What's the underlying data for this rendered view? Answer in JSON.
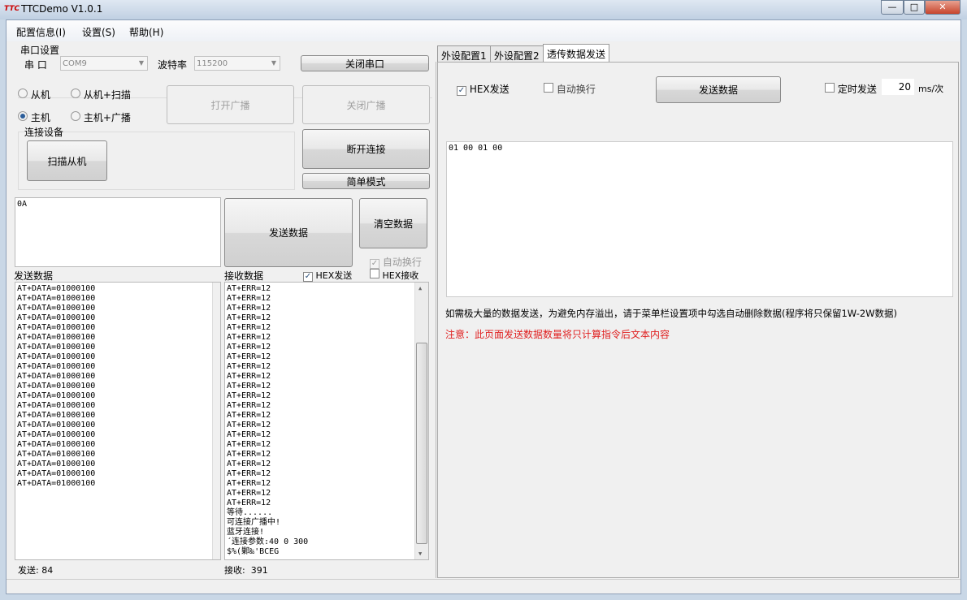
{
  "window": {
    "title": "TTCDemo V1.0.1",
    "logo": "TTC",
    "min": "—",
    "max": "□",
    "close": "✕"
  },
  "menu": [
    "配置信息(I)",
    "设置(S)",
    "帮助(H)"
  ],
  "serial": {
    "group_label": "串口设置",
    "port_label": "串 口",
    "port_value": "COM9",
    "baud_label": "波特率",
    "baud_value": "115200",
    "close_port": "关闭串口"
  },
  "modes": [
    {
      "label": "从机",
      "checked": false
    },
    {
      "label": "从机+扫描",
      "checked": false
    },
    {
      "label": "主机",
      "checked": true
    },
    {
      "label": "主机+广播",
      "checked": false
    }
  ],
  "broadcast": {
    "open": "打开广播",
    "close": "关闭广播"
  },
  "connect": {
    "group_label": "连接设备",
    "scan": "扫描从机",
    "disconnect": "断开连接",
    "simple_mode": "简单模式"
  },
  "left_send": {
    "input_value": "0A",
    "send_button": "发送数据",
    "clear_button": "清空数据",
    "auto_newline": "自动换行",
    "hex_send": "HEX发送",
    "hex_recv": "HEX接收",
    "send_label": "发送数据",
    "recv_label": "接收数据"
  },
  "send_log": [
    "AT+DATA=01000100",
    "AT+DATA=01000100",
    "AT+DATA=01000100",
    "AT+DATA=01000100",
    "AT+DATA=01000100",
    "AT+DATA=01000100",
    "AT+DATA=01000100",
    "AT+DATA=01000100",
    "AT+DATA=01000100",
    "AT+DATA=01000100",
    "AT+DATA=01000100",
    "AT+DATA=01000100",
    "AT+DATA=01000100",
    "AT+DATA=01000100",
    "AT+DATA=01000100",
    "AT+DATA=01000100",
    "AT+DATA=01000100",
    "AT+DATA=01000100",
    "AT+DATA=01000100",
    "AT+DATA=01000100",
    "AT+DATA=01000100"
  ],
  "recv_log": [
    "AT+ERR=12",
    "AT+ERR=12",
    "AT+ERR=12",
    "AT+ERR=12",
    "AT+ERR=12",
    "AT+ERR=12",
    "AT+ERR=12",
    "AT+ERR=12",
    "AT+ERR=12",
    "AT+ERR=12",
    "AT+ERR=12",
    "AT+ERR=12",
    "AT+ERR=12",
    "AT+ERR=12",
    "AT+ERR=12",
    "AT+ERR=12",
    "AT+ERR=12",
    "AT+ERR=12",
    "AT+ERR=12",
    "AT+ERR=12",
    "AT+ERR=12",
    "AT+ERR=12",
    "AT+ERR=12",
    "等待......",
    "可连接广播中!",
    "蓝牙连接!",
    "´连接参数:40 0 300",
    "$%(鄛‰'BCEG"
  ],
  "counters": {
    "sent_label": "发送:",
    "sent_value": "84",
    "recv_label": "接收:",
    "recv_value": "391"
  },
  "tabs": [
    {
      "label": "外设配置1",
      "active": false
    },
    {
      "label": "外设配置2",
      "active": false
    },
    {
      "label": "透传数据发送",
      "active": true
    }
  ],
  "passthrough": {
    "hex_send": "HEX发送",
    "auto_newline": "自动换行",
    "send_button": "发送数据",
    "timed_send": "定时发送",
    "interval": "20",
    "interval_unit": "ms/次",
    "data": "01 00 01 00",
    "info": "如需极大量的数据发送，为避免内存溢出，请于菜单栏设置项中勾选自动删除数据(程序将只保留1W-2W数据)",
    "warning": "注意：此页面发送数据数量将只计算指令后文本内容"
  },
  "colors": {
    "warning": "#e02020",
    "accent": "#2b5d9a"
  }
}
